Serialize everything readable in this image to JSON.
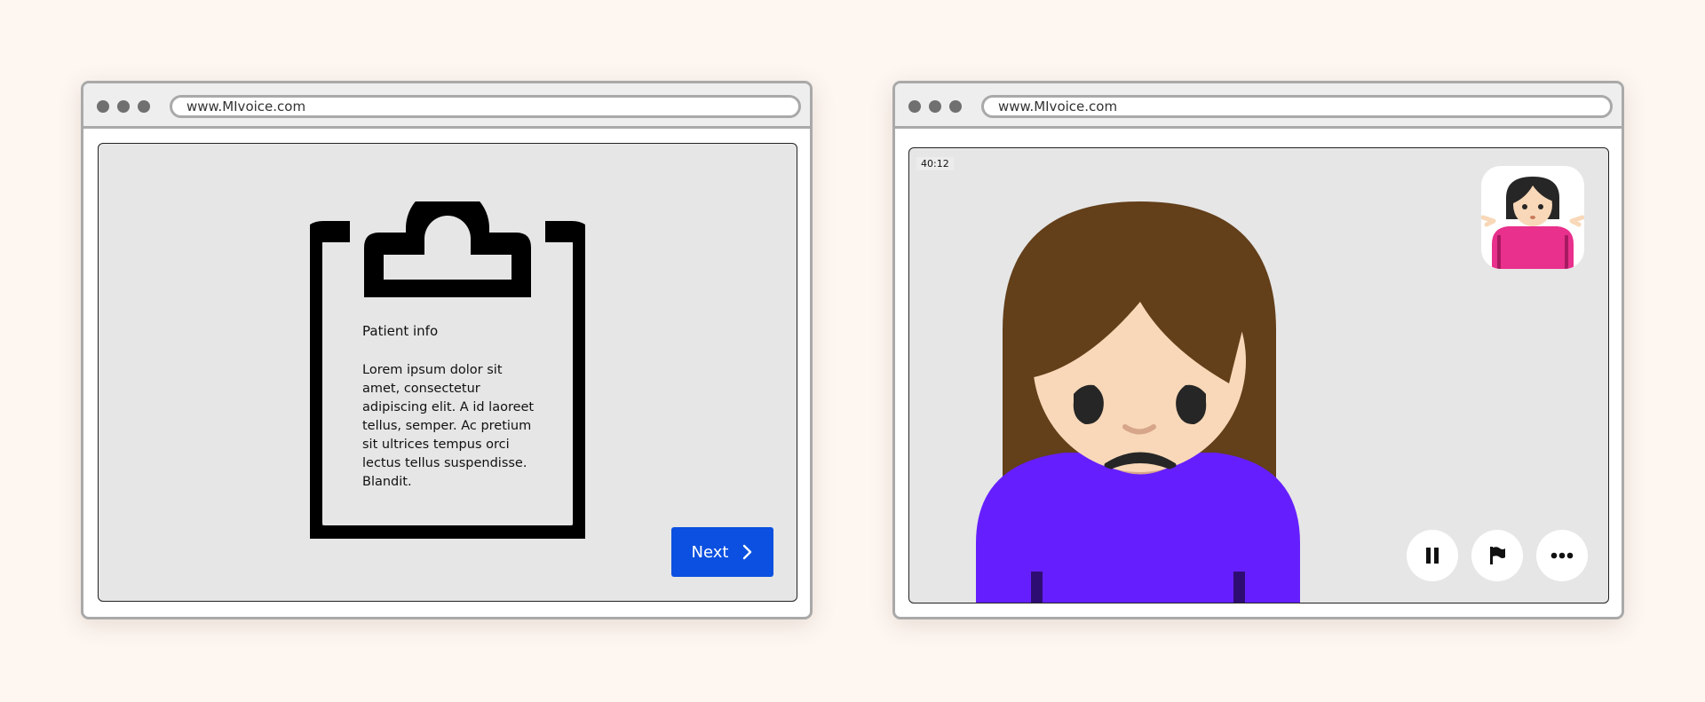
{
  "left_window": {
    "url": "www.MIvoice.com",
    "document": {
      "title": "Patient info",
      "body": "Lorem ipsum dolor sit amet, consectetur adipiscing elit. A id laoreet tellus, semper. Ac pretium sit ultrices tempus orci lectus tellus suspendisse. Blandit."
    },
    "next_button": {
      "label": "Next",
      "icon": "chevron-right-icon"
    }
  },
  "right_window": {
    "url": "www.MIvoice.com",
    "call": {
      "timer": "40:12",
      "remote_participant": "sad-woman-icon",
      "self_view": "person-shrugging-icon",
      "controls": [
        {
          "icon": "pause-icon"
        },
        {
          "icon": "flag-icon"
        },
        {
          "icon": "more-icon"
        }
      ]
    }
  },
  "colors": {
    "background": "#fdf6f1",
    "primary_button": "#0b50e0",
    "shirt": "#651fff",
    "hair": "#633f1a",
    "skin": "#f8d8b8"
  }
}
